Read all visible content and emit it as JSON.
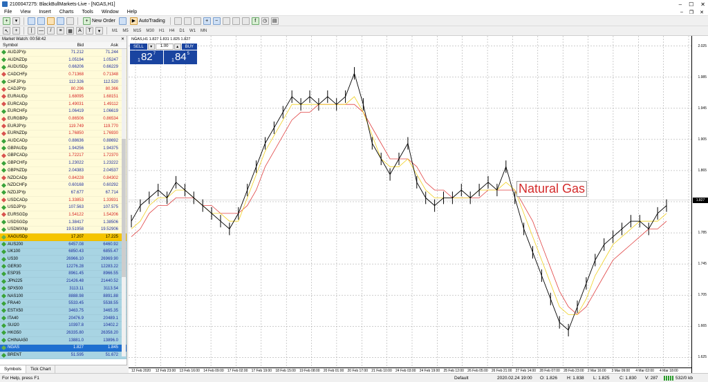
{
  "window": {
    "title": "2100047275: BlackBullMarkets-Live - [NGAS,H1]"
  },
  "menu": [
    "File",
    "View",
    "Insert",
    "Charts",
    "Tools",
    "Window",
    "Help"
  ],
  "toolbar": {
    "new_order": "New Order",
    "autotrading": "AutoTrading",
    "timeframes": [
      "M1",
      "M5",
      "M15",
      "M30",
      "H1",
      "H4",
      "D1",
      "W1",
      "MN"
    ]
  },
  "market_watch": {
    "title": "Market Watch: 00:58:42",
    "headers": {
      "symbol": "Symbol",
      "bid": "Bid",
      "ask": "Ask"
    },
    "rows": [
      {
        "s": "AUDJPYp",
        "b": "71.212",
        "a": "71.244",
        "c": "y",
        "d": "dg"
      },
      {
        "s": "AUDNZDp",
        "b": "1.05194",
        "a": "1.05247",
        "c": "y",
        "d": "dg"
      },
      {
        "s": "AUDUSDp",
        "b": "0.66206",
        "a": "0.66229",
        "c": "y",
        "d": "dg"
      },
      {
        "s": "CADCHFp",
        "b": "0.71368",
        "a": "0.71348",
        "c": "yr",
        "d": "dr"
      },
      {
        "s": "CHFJPYp",
        "b": "112.326",
        "a": "112.520",
        "c": "y",
        "d": "dg"
      },
      {
        "s": "CADJPYp",
        "b": "80.296",
        "a": "80.366",
        "c": "yr",
        "d": "dr"
      },
      {
        "s": "EURAUDp",
        "b": "1.68095",
        "a": "1.68151",
        "c": "yr",
        "d": "dr"
      },
      {
        "s": "EURCADp",
        "b": "1.49031",
        "a": "1.49112",
        "c": "yr",
        "d": "dr"
      },
      {
        "s": "EURCHFp",
        "b": "1.06419",
        "a": "1.06619",
        "c": "y",
        "d": "dg"
      },
      {
        "s": "EURGBPp",
        "b": "0.86506",
        "a": "0.86534",
        "c": "yr",
        "d": "dr"
      },
      {
        "s": "EURJPYp",
        "b": "119.749",
        "a": "119.770",
        "c": "yr",
        "d": "dr"
      },
      {
        "s": "EURNZDp",
        "b": "1.76850",
        "a": "1.76930",
        "c": "yr",
        "d": "dr"
      },
      {
        "s": "AUDCADp",
        "b": "0.88636",
        "a": "0.88692",
        "c": "y",
        "d": "dg"
      },
      {
        "s": "GBPAUDp",
        "b": "1.94256",
        "a": "1.94375",
        "c": "y",
        "d": "dg"
      },
      {
        "s": "GBPCADp",
        "b": "1.72217",
        "a": "1.72370",
        "c": "yr",
        "d": "dr"
      },
      {
        "s": "GBPCHFp",
        "b": "1.23022",
        "a": "1.23222",
        "c": "y",
        "d": "dg"
      },
      {
        "s": "GBPNZDp",
        "b": "2.04383",
        "a": "2.04537",
        "c": "y",
        "d": "dg"
      },
      {
        "s": "NZDCADp",
        "b": "0.84228",
        "a": "0.84302",
        "c": "yr",
        "d": "dr"
      },
      {
        "s": "NZDCHFp",
        "b": "0.60168",
        "a": "0.60292",
        "c": "y",
        "d": "dg"
      },
      {
        "s": "NZDJPYp",
        "b": "67.677",
        "a": "67.714",
        "c": "y",
        "d": "dg"
      },
      {
        "s": "USDCADp",
        "b": "1.33853",
        "a": "1.33931",
        "c": "yr",
        "d": "dr"
      },
      {
        "s": "USDJPYp",
        "b": "107.563",
        "a": "107.575",
        "c": "y",
        "d": "dg"
      },
      {
        "s": "EURSGDp",
        "b": "1.54122",
        "a": "1.54206",
        "c": "yr",
        "d": "dr"
      },
      {
        "s": "USDSGDp",
        "b": "1.38417",
        "a": "1.38506",
        "c": "y",
        "d": "dg"
      },
      {
        "s": "USDMXNp",
        "b": "19.51958",
        "a": "19.52906",
        "c": "y",
        "d": "dg"
      },
      {
        "s": "XAGUSDp",
        "b": "17.207",
        "a": "17.225",
        "c": "sel",
        "d": "dy"
      },
      {
        "s": "AUS200",
        "b": "6457.08",
        "a": "6460.92",
        "c": "b",
        "d": "dg"
      },
      {
        "s": "UK100",
        "b": "6850.43",
        "a": "6855.47",
        "c": "b",
        "d": "dg"
      },
      {
        "s": "US30",
        "b": "26966.10",
        "a": "26969.90",
        "c": "b",
        "d": "dg"
      },
      {
        "s": "GER30",
        "b": "12276.28",
        "a": "12283.22",
        "c": "b",
        "d": "dg"
      },
      {
        "s": "ESP35",
        "b": "8961.45",
        "a": "8966.55",
        "c": "b",
        "d": "dg"
      },
      {
        "s": "JPN225",
        "b": "21426.48",
        "a": "21440.52",
        "c": "b",
        "d": "dg"
      },
      {
        "s": "SPX500",
        "b": "3113.11",
        "a": "3113.54",
        "c": "b",
        "d": "dg"
      },
      {
        "s": "NAS100",
        "b": "8888.98",
        "a": "8891.88",
        "c": "b",
        "d": "dg"
      },
      {
        "s": "FRA40",
        "b": "5533.45",
        "a": "5538.55",
        "c": "b",
        "d": "dg"
      },
      {
        "s": "ESTX50",
        "b": "3463.75",
        "a": "3465.35",
        "c": "b",
        "d": "dg"
      },
      {
        "s": "ITA40",
        "b": "20476.9",
        "a": "20489.1",
        "c": "b",
        "d": "dg"
      },
      {
        "s": "SUI20",
        "b": "10397.8",
        "a": "10402.2",
        "c": "b",
        "d": "dg"
      },
      {
        "s": "HKG50",
        "b": "26335.80",
        "a": "26358.20",
        "c": "b",
        "d": "dg"
      },
      {
        "s": "CHINAA50",
        "b": "13881.0",
        "a": "13896.0",
        "c": "b",
        "d": "dg"
      },
      {
        "s": "NGAS",
        "b": "1.827",
        "a": "1.845",
        "c": "hi",
        "d": "dy"
      },
      {
        "s": "BRENT",
        "b": "51.595",
        "a": "51.672",
        "c": "b",
        "d": "dg"
      }
    ],
    "tabs": [
      "Symbols",
      "Tick Chart"
    ]
  },
  "chart": {
    "header": "NGAS,H1  1.827 1.831 1.825 1.827",
    "trade_panel": {
      "sell": "SELL",
      "buy": "BUY",
      "lot": "1.00",
      "sell_small": "1",
      "sell_big": "82",
      "sell_sup": "7",
      "buy_small": "1",
      "buy_big": "84",
      "buy_sup": "5"
    },
    "label": "Natural Gas",
    "current_price": "1.827"
  },
  "chart_data": {
    "type": "line",
    "yticks": [
      "2.025",
      "1.985",
      "1.945",
      "1.905",
      "1.865",
      "1.825",
      "1.785",
      "1.745",
      "1.705",
      "1.665",
      "1.625"
    ],
    "ytick_values": [
      2.025,
      1.985,
      1.945,
      1.905,
      1.865,
      1.825,
      1.785,
      1.745,
      1.705,
      1.665,
      1.625
    ],
    "xticks": [
      "12 Feb 2020",
      "12 Feb 23:00",
      "13 Feb 16:00",
      "14 Feb 09:00",
      "17 Feb 02:00",
      "17 Feb 19:00",
      "18 Feb 15:00",
      "19 Feb 08:00",
      "20 Feb 01:00",
      "20 Feb 17:00",
      "21 Feb 10:00",
      "24 Feb 03:00",
      "24 Feb 19:00",
      "25 Feb 12:00",
      "26 Feb 05:00",
      "26 Feb 21:00",
      "27 Feb 14:00",
      "28 Feb 07:00",
      "28 Feb 23:00",
      "2 Mar 16:00",
      "3 Mar 09:00",
      "4 Mar 02:00",
      "4 Mar 18:00"
    ],
    "ylim": [
      1.612,
      2.038
    ],
    "series": [
      {
        "values": [
          1.8,
          1.82,
          1.83,
          1.84,
          1.83,
          1.85,
          1.84,
          1.83,
          1.82,
          1.81,
          1.8,
          1.79,
          1.81,
          1.84,
          1.87,
          1.9,
          1.92,
          1.94,
          1.96,
          1.95,
          1.96,
          1.95,
          1.96,
          1.95,
          1.96,
          1.99,
          1.95,
          1.9,
          1.88,
          1.86,
          1.88,
          1.9,
          1.85,
          1.83,
          1.82,
          1.83,
          1.83,
          1.84,
          1.83,
          1.84,
          1.85,
          1.84,
          1.87,
          1.83,
          1.79,
          1.76,
          1.73,
          1.7,
          1.67,
          1.66,
          1.69,
          1.72,
          1.75,
          1.77,
          1.78,
          1.79,
          1.8,
          1.8,
          1.79,
          1.81,
          1.82
        ]
      },
      {
        "values": [
          1.79,
          1.8,
          1.82,
          1.83,
          1.83,
          1.84,
          1.84,
          1.83,
          1.82,
          1.81,
          1.81,
          1.8,
          1.8,
          1.83,
          1.86,
          1.89,
          1.91,
          1.93,
          1.95,
          1.95,
          1.95,
          1.95,
          1.95,
          1.95,
          1.95,
          1.96,
          1.94,
          1.91,
          1.88,
          1.87,
          1.87,
          1.88,
          1.86,
          1.84,
          1.83,
          1.83,
          1.83,
          1.83,
          1.83,
          1.84,
          1.84,
          1.84,
          1.85,
          1.84,
          1.81,
          1.78,
          1.75,
          1.72,
          1.69,
          1.68,
          1.68,
          1.7,
          1.73,
          1.75,
          1.77,
          1.78,
          1.79,
          1.8,
          1.8,
          1.8,
          1.81
        ]
      },
      {
        "values": [
          1.78,
          1.79,
          1.81,
          1.82,
          1.82,
          1.83,
          1.83,
          1.83,
          1.82,
          1.82,
          1.81,
          1.81,
          1.81,
          1.82,
          1.84,
          1.87,
          1.89,
          1.91,
          1.93,
          1.94,
          1.94,
          1.95,
          1.95,
          1.95,
          1.95,
          1.95,
          1.94,
          1.92,
          1.9,
          1.88,
          1.88,
          1.88,
          1.87,
          1.85,
          1.84,
          1.84,
          1.83,
          1.83,
          1.83,
          1.83,
          1.84,
          1.84,
          1.84,
          1.84,
          1.82,
          1.8,
          1.77,
          1.74,
          1.71,
          1.69,
          1.68,
          1.69,
          1.71,
          1.73,
          1.75,
          1.76,
          1.77,
          1.78,
          1.79,
          1.79,
          1.8
        ]
      }
    ],
    "colors": {
      "price": "#000000",
      "ma_fast": "#f0d020",
      "ma_slow": "#e04040",
      "grid": "#9a9a9a"
    },
    "grid": true
  },
  "statusbar": {
    "help": "For Help, press F1",
    "profile": "Default",
    "time": "2020.02.24 19:00",
    "open": "O: 1.826",
    "high": "H: 1.838",
    "low": "L: 1.825",
    "close": "C: 1.830",
    "volume": "V: 287",
    "traffic": "532/0 kb"
  }
}
